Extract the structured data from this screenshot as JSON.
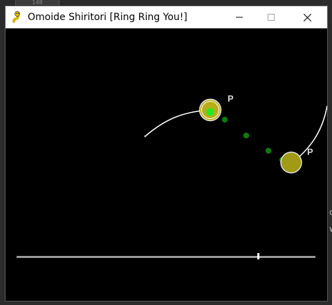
{
  "window": {
    "title": "Omoide Shiritori [Ring Ring You!]",
    "icon": "snake-icon",
    "controls": [
      "minimize",
      "maximize",
      "close"
    ]
  },
  "background": {
    "tab_label": "148",
    "side_chars": [
      "c",
      "w"
    ]
  },
  "game": {
    "player_label": "P",
    "colors": {
      "ring_fill": "#b7ad18",
      "ring_fill_alt": "#a09a14",
      "ring_outline": "#e8e8e8",
      "hit_green": "#25e81f",
      "dot_green": "#0e7a0e",
      "trail": "#ffffff"
    },
    "path_dot_count": 4
  },
  "seekbar": {
    "progress": 0.81
  }
}
